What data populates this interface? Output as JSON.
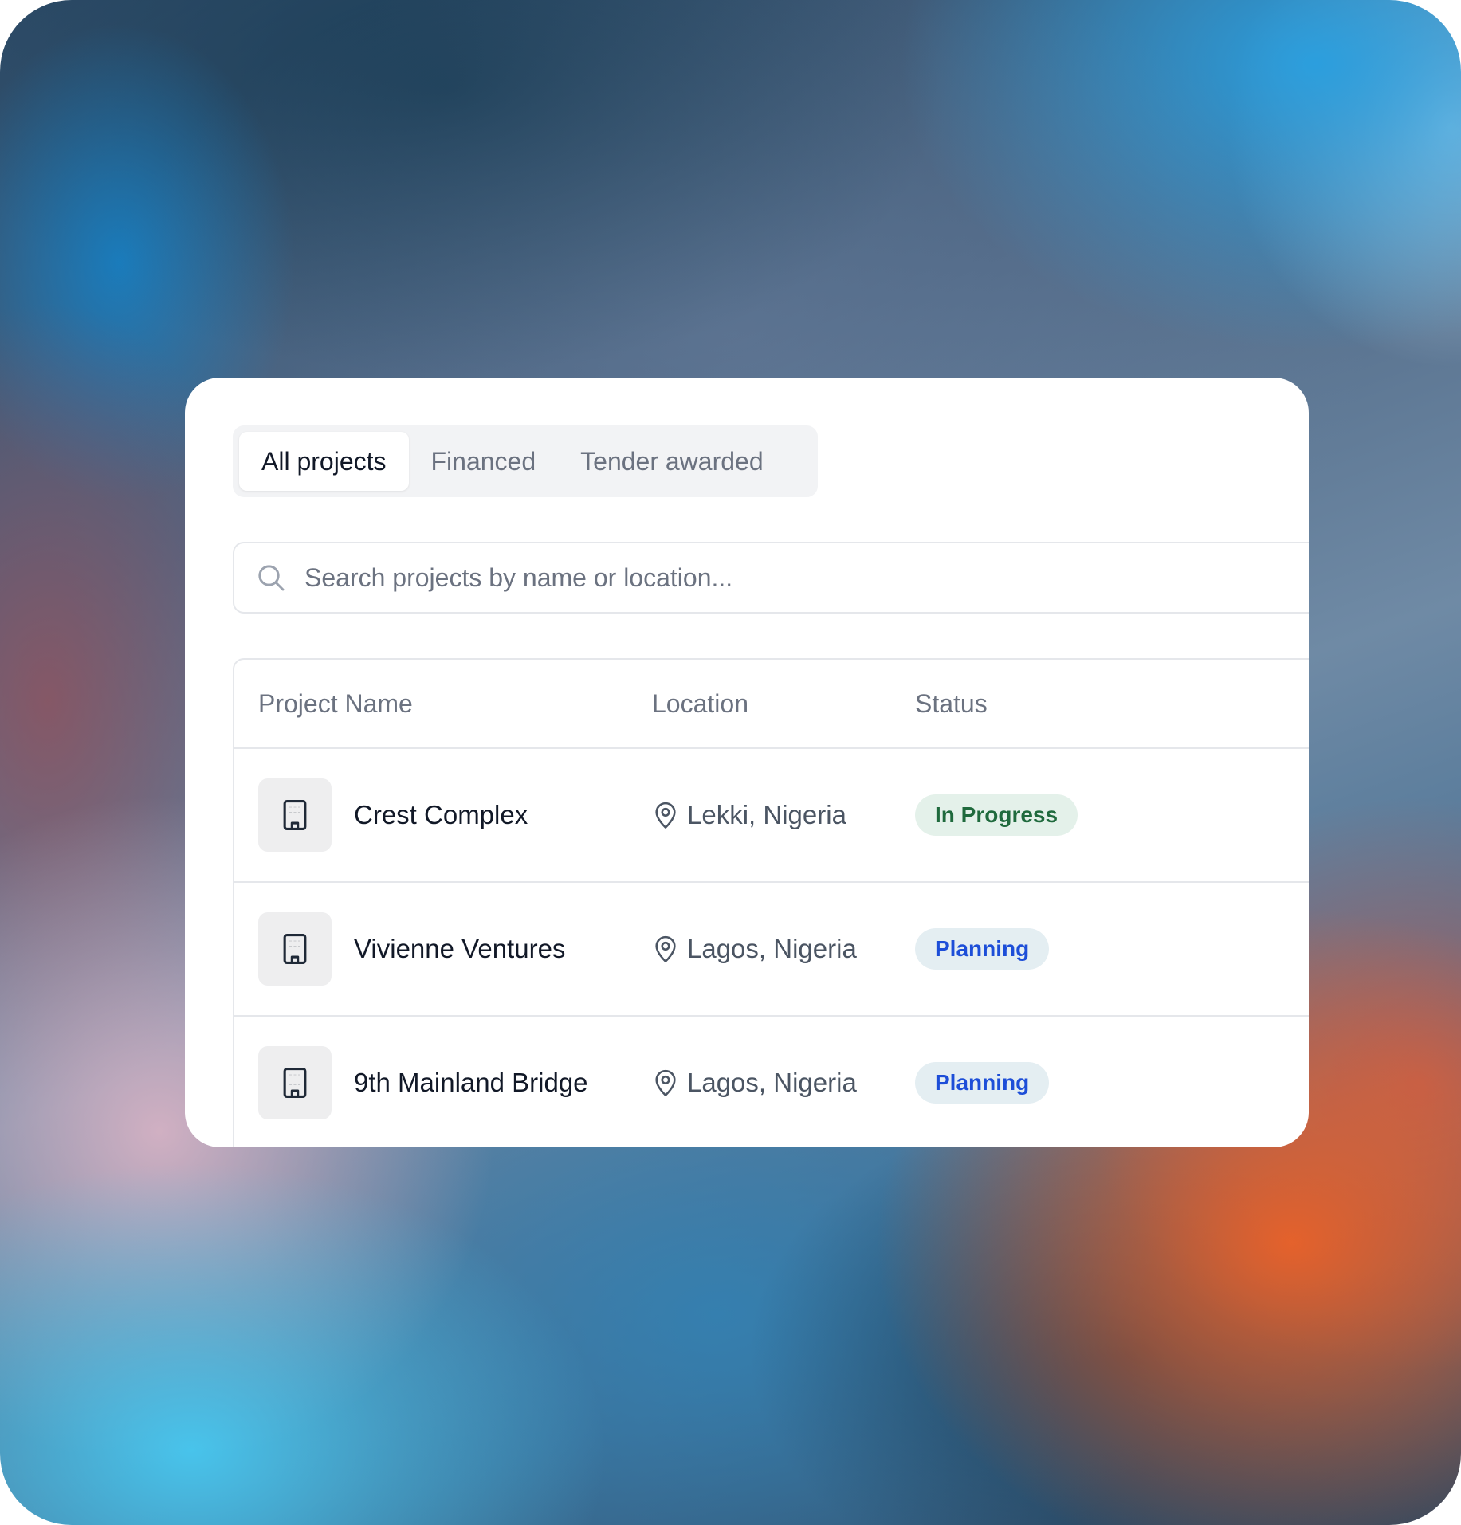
{
  "tabs": [
    {
      "label": "All projects",
      "active": true
    },
    {
      "label": "Financed",
      "active": false
    },
    {
      "label": "Tender awarded",
      "active": false
    }
  ],
  "search": {
    "placeholder": "Search projects by name or location...",
    "icon": "search-icon"
  },
  "table": {
    "headers": [
      "Project Name",
      "Location",
      "Status"
    ],
    "rows": [
      {
        "name": "Crest Complex",
        "location": "Lekki, Nigeria",
        "status": "In Progress",
        "status_kind": "progress"
      },
      {
        "name": "Vivienne Ventures",
        "location": "Lagos, Nigeria",
        "status": "Planning",
        "status_kind": "planning"
      },
      {
        "name": "9th Mainland Bridge",
        "location": "Lagos, Nigeria",
        "status": "Planning",
        "status_kind": "planning"
      }
    ]
  },
  "colors": {
    "in_progress_bg": "#e4f1ea",
    "in_progress_text": "#1f6a3d",
    "planning_bg": "#e4eef2",
    "planning_text": "#1d4ed8"
  }
}
